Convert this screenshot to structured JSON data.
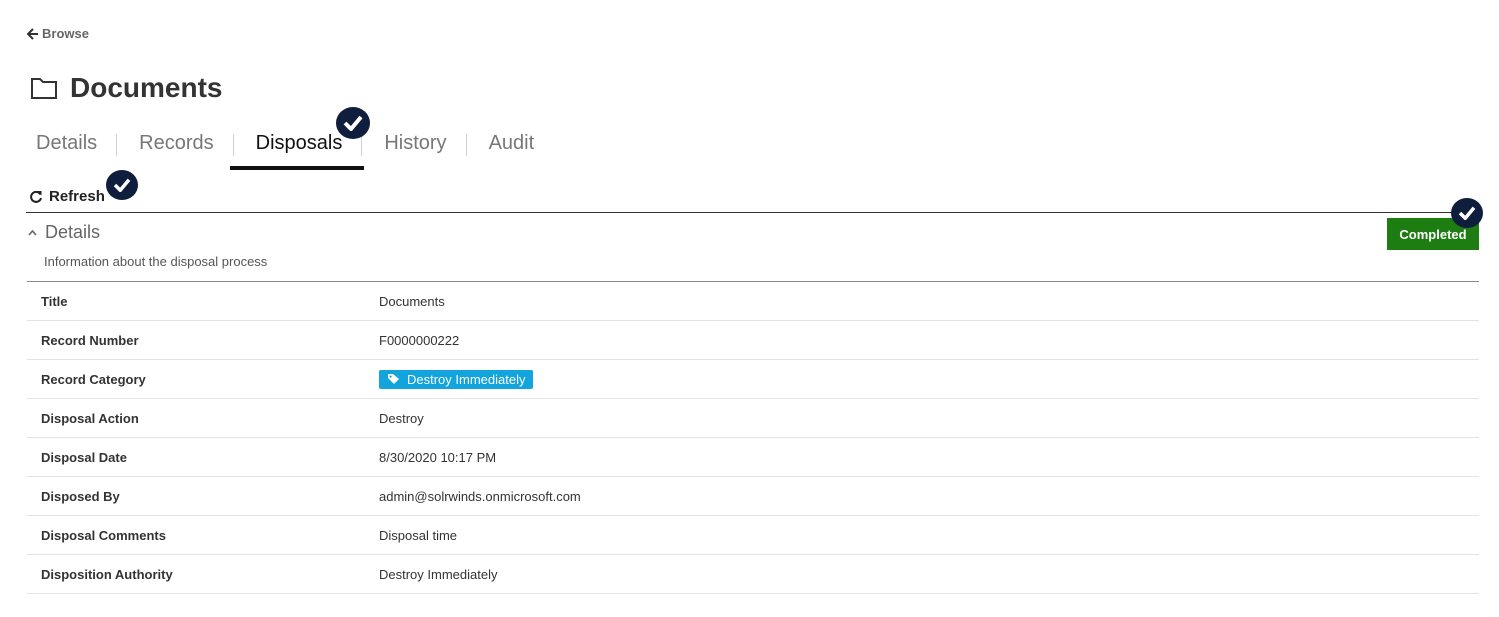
{
  "nav": {
    "back_label": "Browse"
  },
  "page": {
    "title": "Documents"
  },
  "tabs": [
    {
      "label": "Details"
    },
    {
      "label": "Records"
    },
    {
      "label": "Disposals",
      "active": true
    },
    {
      "label": "History"
    },
    {
      "label": "Audit"
    }
  ],
  "toolbar": {
    "refresh_label": "Refresh"
  },
  "section": {
    "title": "Details",
    "description": "Information about the disposal process",
    "status": "Completed",
    "status_color": "#1e7d12"
  },
  "fields": [
    {
      "key": "Title",
      "value": "Documents"
    },
    {
      "key": "Record Number",
      "value": "F0000000222"
    },
    {
      "key": "Record Category",
      "value": "Destroy Immediately",
      "tag": true
    },
    {
      "key": "Disposal Action",
      "value": "Destroy"
    },
    {
      "key": "Disposal Date",
      "value": "8/30/2020 10:17 PM"
    },
    {
      "key": "Disposed By",
      "value": "admin@solrwinds.onmicrosoft.com"
    },
    {
      "key": "Disposal Comments",
      "value": "Disposal time"
    },
    {
      "key": "Disposition Authority",
      "value": "Destroy Immediately"
    }
  ],
  "colors": {
    "accent_dark": "#0f1e3c",
    "tag_blue": "#12a4dd"
  }
}
